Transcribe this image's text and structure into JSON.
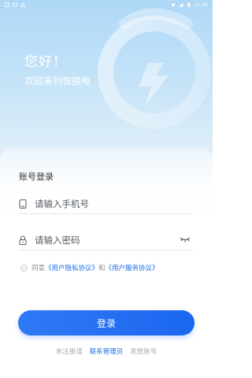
{
  "status_bar": {
    "time": "11:00"
  },
  "greeting": {
    "title": "您好！",
    "subtitle": "欢迎来到悦换电"
  },
  "login_form": {
    "title": "账号登录",
    "phone_placeholder": "请输入手机号",
    "password_placeholder": "请输入密码",
    "agreement_prefix": "同意",
    "privacy_link": "《用户隐私协议》",
    "agreement_and": "和",
    "service_link": "《用户服务协议》",
    "submit_label": "登录"
  },
  "footer": {
    "unregistered_text": "未注册请",
    "contact_admin": "联系管理员",
    "issue_account": "发放账号"
  },
  "colors": {
    "primary": "#1e6fe8",
    "button": "#2a75f3",
    "background_top": "#aed8f7"
  },
  "icons": {
    "phone_field": "phone-icon",
    "password_field": "lock-icon",
    "password_visibility": "eye-closed-icon",
    "agreement": "check-circle-icon",
    "decoration": "lightning-icon"
  }
}
